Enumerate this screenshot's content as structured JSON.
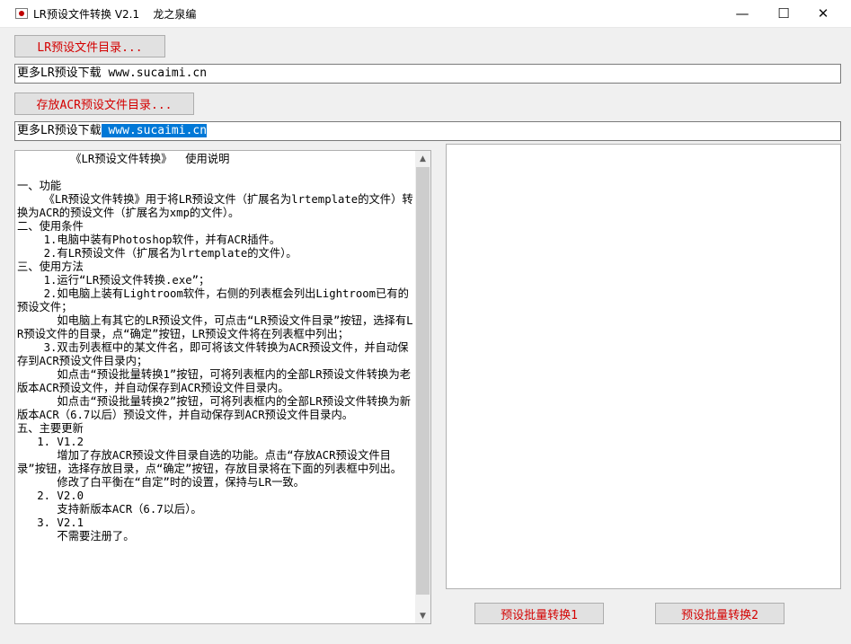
{
  "window": {
    "title": "LR预设文件转换 V2.1    龙之泉编",
    "controls": {
      "minimize": "—",
      "maximize": "☐",
      "close": "✕"
    }
  },
  "toolbar": {
    "lr_dir_button": "LR预设文件目录...",
    "lr_dir_value": "更多LR预设下载 www.sucaimi.cn",
    "acr_dir_button": "存放ACR预设文件目录...",
    "acr_dir_value_prefix": "更多LR预设下载",
    "acr_dir_value_selected": " www.sucaimi.cn"
  },
  "instructions": {
    "lines": [
      "        《LR预设文件转换》  使用说明",
      "",
      "一、功能",
      "    《LR预设文件转换》用于将LR预设文件（扩展名为lrtemplate的文件）转换为ACR的预设文件（扩展名为xmp的文件）。",
      "二、使用条件",
      "    1.电脑中装有Photoshop软件，并有ACR插件。",
      "    2.有LR预设文件（扩展名为lrtemplate的文件）。",
      "三、使用方法",
      "    1.运行“LR预设文件转换.exe”；",
      "    2.如电脑上装有Lightroom软件，右侧的列表框会列出Lightroom已有的预设文件；",
      "      如电脑上有其它的LR预设文件，可点击“LR预设文件目录”按钮，选择有LR预设文件的目录，点“确定”按钮，LR预设文件将在列表框中列出；",
      "    3.双击列表框中的某文件名，即可将该文件转换为ACR预设文件，并自动保存到ACR预设文件目录内；",
      "      如点击“预设批量转换1”按钮，可将列表框内的全部LR预设文件转换为老版本ACR预设文件，并自动保存到ACR预设文件目录内。",
      "      如点击“预设批量转换2”按钮，可将列表框内的全部LR预设文件转换为新版本ACR（6.7以后）预设文件，并自动保存到ACR预设文件目录内。",
      "五、主要更新",
      "   1. V1.2",
      "      增加了存放ACR预设文件目录自选的功能。点击“存放ACR预设文件目录”按钮，选择存放目录，点“确定”按钮，存放目录将在下面的列表框中列出。",
      "      修改了白平衡在“自定”时的设置，保持与LR一致。",
      "   2. V2.0",
      "      支持新版本ACR（6.7以后）。",
      "   3. V2.1",
      "      不需要注册了。"
    ]
  },
  "actions": {
    "batch1_label": "预设批量转换1",
    "batch2_label": "预设批量转换2"
  },
  "colors": {
    "button_text": "#d40000",
    "selection": "#0078d7",
    "window_bg": "#f0f0f0"
  }
}
